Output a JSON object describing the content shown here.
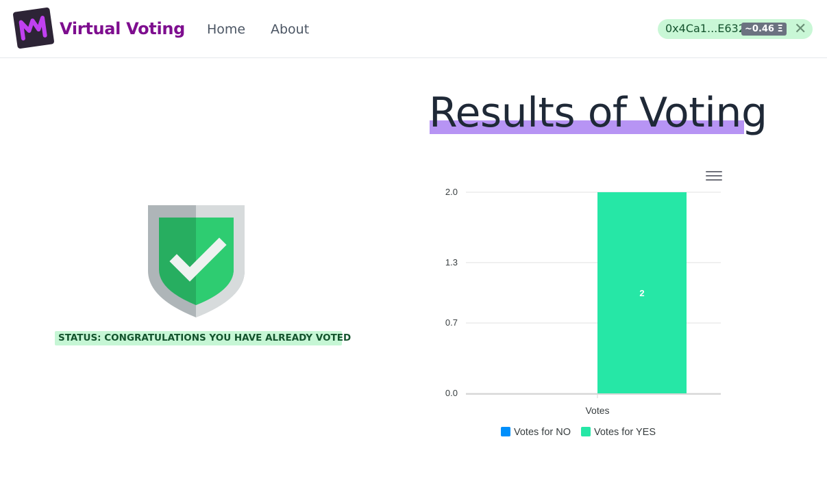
{
  "app": {
    "title": "Virtual Voting",
    "logo_letter": "M"
  },
  "nav": {
    "home": "Home",
    "about": "About"
  },
  "wallet": {
    "address": "0x4Ca1...E632",
    "balance": "~0.46 Ξ",
    "close_glyph": "✕"
  },
  "status": {
    "text": "STATUS: CONGRATULATIONS YOU HAVE ALREADY VOTED"
  },
  "results": {
    "title": "Results of Voting"
  },
  "colors": {
    "accent": "#7e0e8f",
    "highlight": "#b794f4",
    "no_series": "#008ffb",
    "yes_series": "#26e7a6"
  },
  "chart_data": {
    "type": "bar",
    "categories": [
      "Votes"
    ],
    "series": [
      {
        "name": "Votes for NO",
        "values": [
          0
        ],
        "color": "#008ffb"
      },
      {
        "name": "Votes for YES",
        "values": [
          2
        ],
        "color": "#26e7a6"
      }
    ],
    "ylim": [
      0,
      2
    ],
    "yticks": [
      "0.0",
      "0.7",
      "1.3",
      "2.0"
    ],
    "data_labels": [
      "2"
    ],
    "grid": true,
    "legend": "bottom"
  }
}
